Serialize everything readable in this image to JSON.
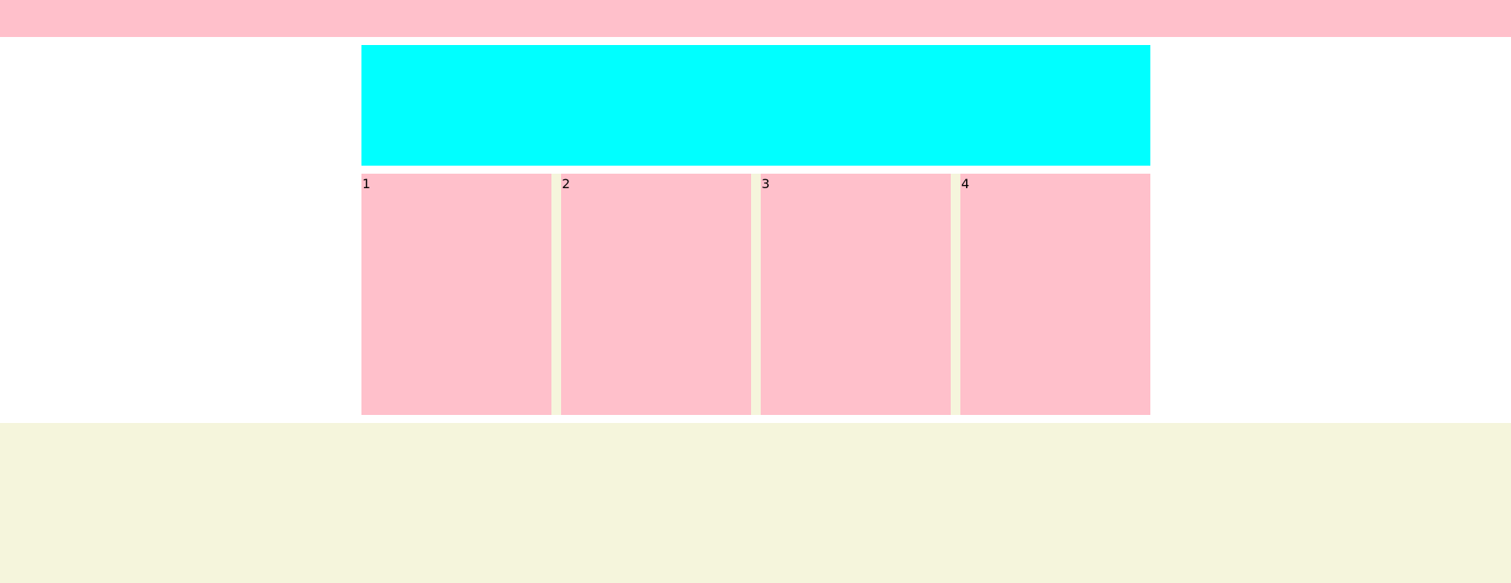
{
  "colors": {
    "top_bar": "#ffc0cb",
    "banner": "#00ffff",
    "card": "#ffc0cb",
    "gutter": "#f5f5dc",
    "footer": "#f5f5dc",
    "background": "#ffffff"
  },
  "cards": [
    {
      "label": "1"
    },
    {
      "label": "2"
    },
    {
      "label": "3"
    },
    {
      "label": "4"
    }
  ]
}
